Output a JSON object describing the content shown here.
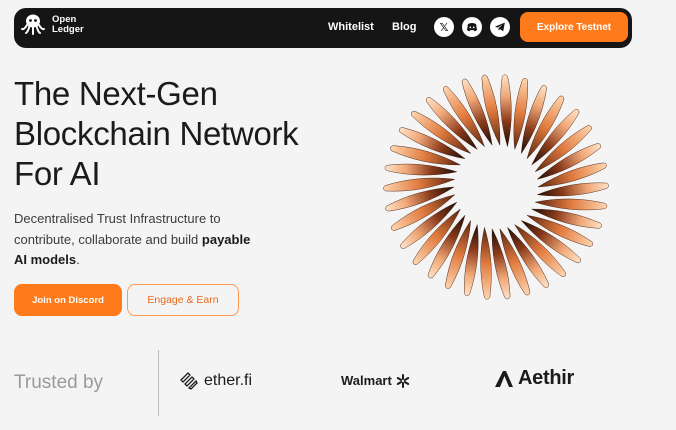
{
  "nav": {
    "logo_line1": "Open",
    "logo_line2": "Ledger",
    "links": [
      "Whitelist",
      "Blog"
    ],
    "social": [
      {
        "icon": "x-icon",
        "glyph": "𝕏"
      },
      {
        "icon": "discord-icon",
        "glyph": "◉"
      },
      {
        "icon": "telegram-icon",
        "glyph": "➤"
      }
    ],
    "cta": "Explore Testnet"
  },
  "hero": {
    "title_line1": "The Next-Gen",
    "title_line2": "Blockchain Network",
    "title_line3": "For AI",
    "subtitle_line1": "Decentralised Trust Infrastructure to",
    "subtitle_line2_plain": "contribute, collaborate and build ",
    "subtitle_line2_bold": "payable",
    "subtitle_line3_bold": "AI models",
    "subtitle_line3_end": ".",
    "primary_button": "Join on Discord",
    "secondary_button": "Engage & Earn"
  },
  "trusted": {
    "label": "Trusted by",
    "logos": [
      "ether.fi",
      "Walmart",
      "Aethir"
    ]
  },
  "colors": {
    "accent": "#ff7a1a",
    "nav_bg": "#151515",
    "page_bg": "#f4f4f4"
  }
}
